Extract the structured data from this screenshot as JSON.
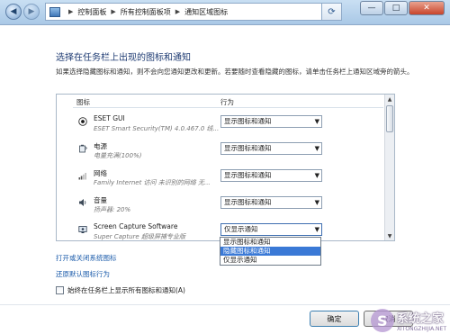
{
  "address_bar": {
    "crumbs": [
      "控制面板",
      "所有控制面板项",
      "通知区域图标"
    ]
  },
  "page": {
    "title": "选择在任务栏上出现的图标和通知",
    "description": "如果选择隐藏图标和通知，则不会向您通知更改和更新。若要随时查看隐藏的图标，请单击任务栏上通知区域旁的箭头。"
  },
  "list": {
    "header_icons": "图标",
    "header_behavior": "行为",
    "rows": [
      {
        "name": "ESET GUI",
        "sub": "ESET Smart Security(TM) 4.0.467.0 线...",
        "behavior": "显示图标和通知",
        "icon": "eset-icon"
      },
      {
        "name": "电源",
        "sub": "电量充满(100%)",
        "behavior": "显示图标和通知",
        "icon": "power-icon"
      },
      {
        "name": "网络",
        "sub": "Family Internet 访问 未识别的网络 无...",
        "behavior": "显示图标和通知",
        "icon": "network-icon"
      },
      {
        "name": "音量",
        "sub": "扬声器: 20%",
        "behavior": "显示图标和通知",
        "icon": "volume-icon"
      },
      {
        "name": "Screen Capture Software",
        "sub": "Super Capture 超级屏捕专业版",
        "behavior": "仅显示通知",
        "icon": "screen-capture-icon"
      }
    ]
  },
  "dropdown": {
    "options": [
      "显示图标和通知",
      "隐藏图标和通知",
      "仅显示通知"
    ],
    "highlighted_index": 1
  },
  "links": {
    "system_icons": "打开或关闭系统图标",
    "restore_defaults": "还原默认图标行为"
  },
  "checkbox": {
    "label": "始终在任务栏上显示所有图标和通知(A)",
    "checked": false
  },
  "buttons": {
    "ok": "确定",
    "cancel": "取消"
  },
  "window_controls": {
    "minimize": "—",
    "maximize": "□",
    "close": "✕"
  },
  "watermark": {
    "logo_letter": "S",
    "title": "系统之家",
    "url": "XITONGZHIJIA.NET"
  },
  "colors": {
    "link": "#1c5cab",
    "title": "#1d3a72",
    "selection": "#3a79d6"
  }
}
